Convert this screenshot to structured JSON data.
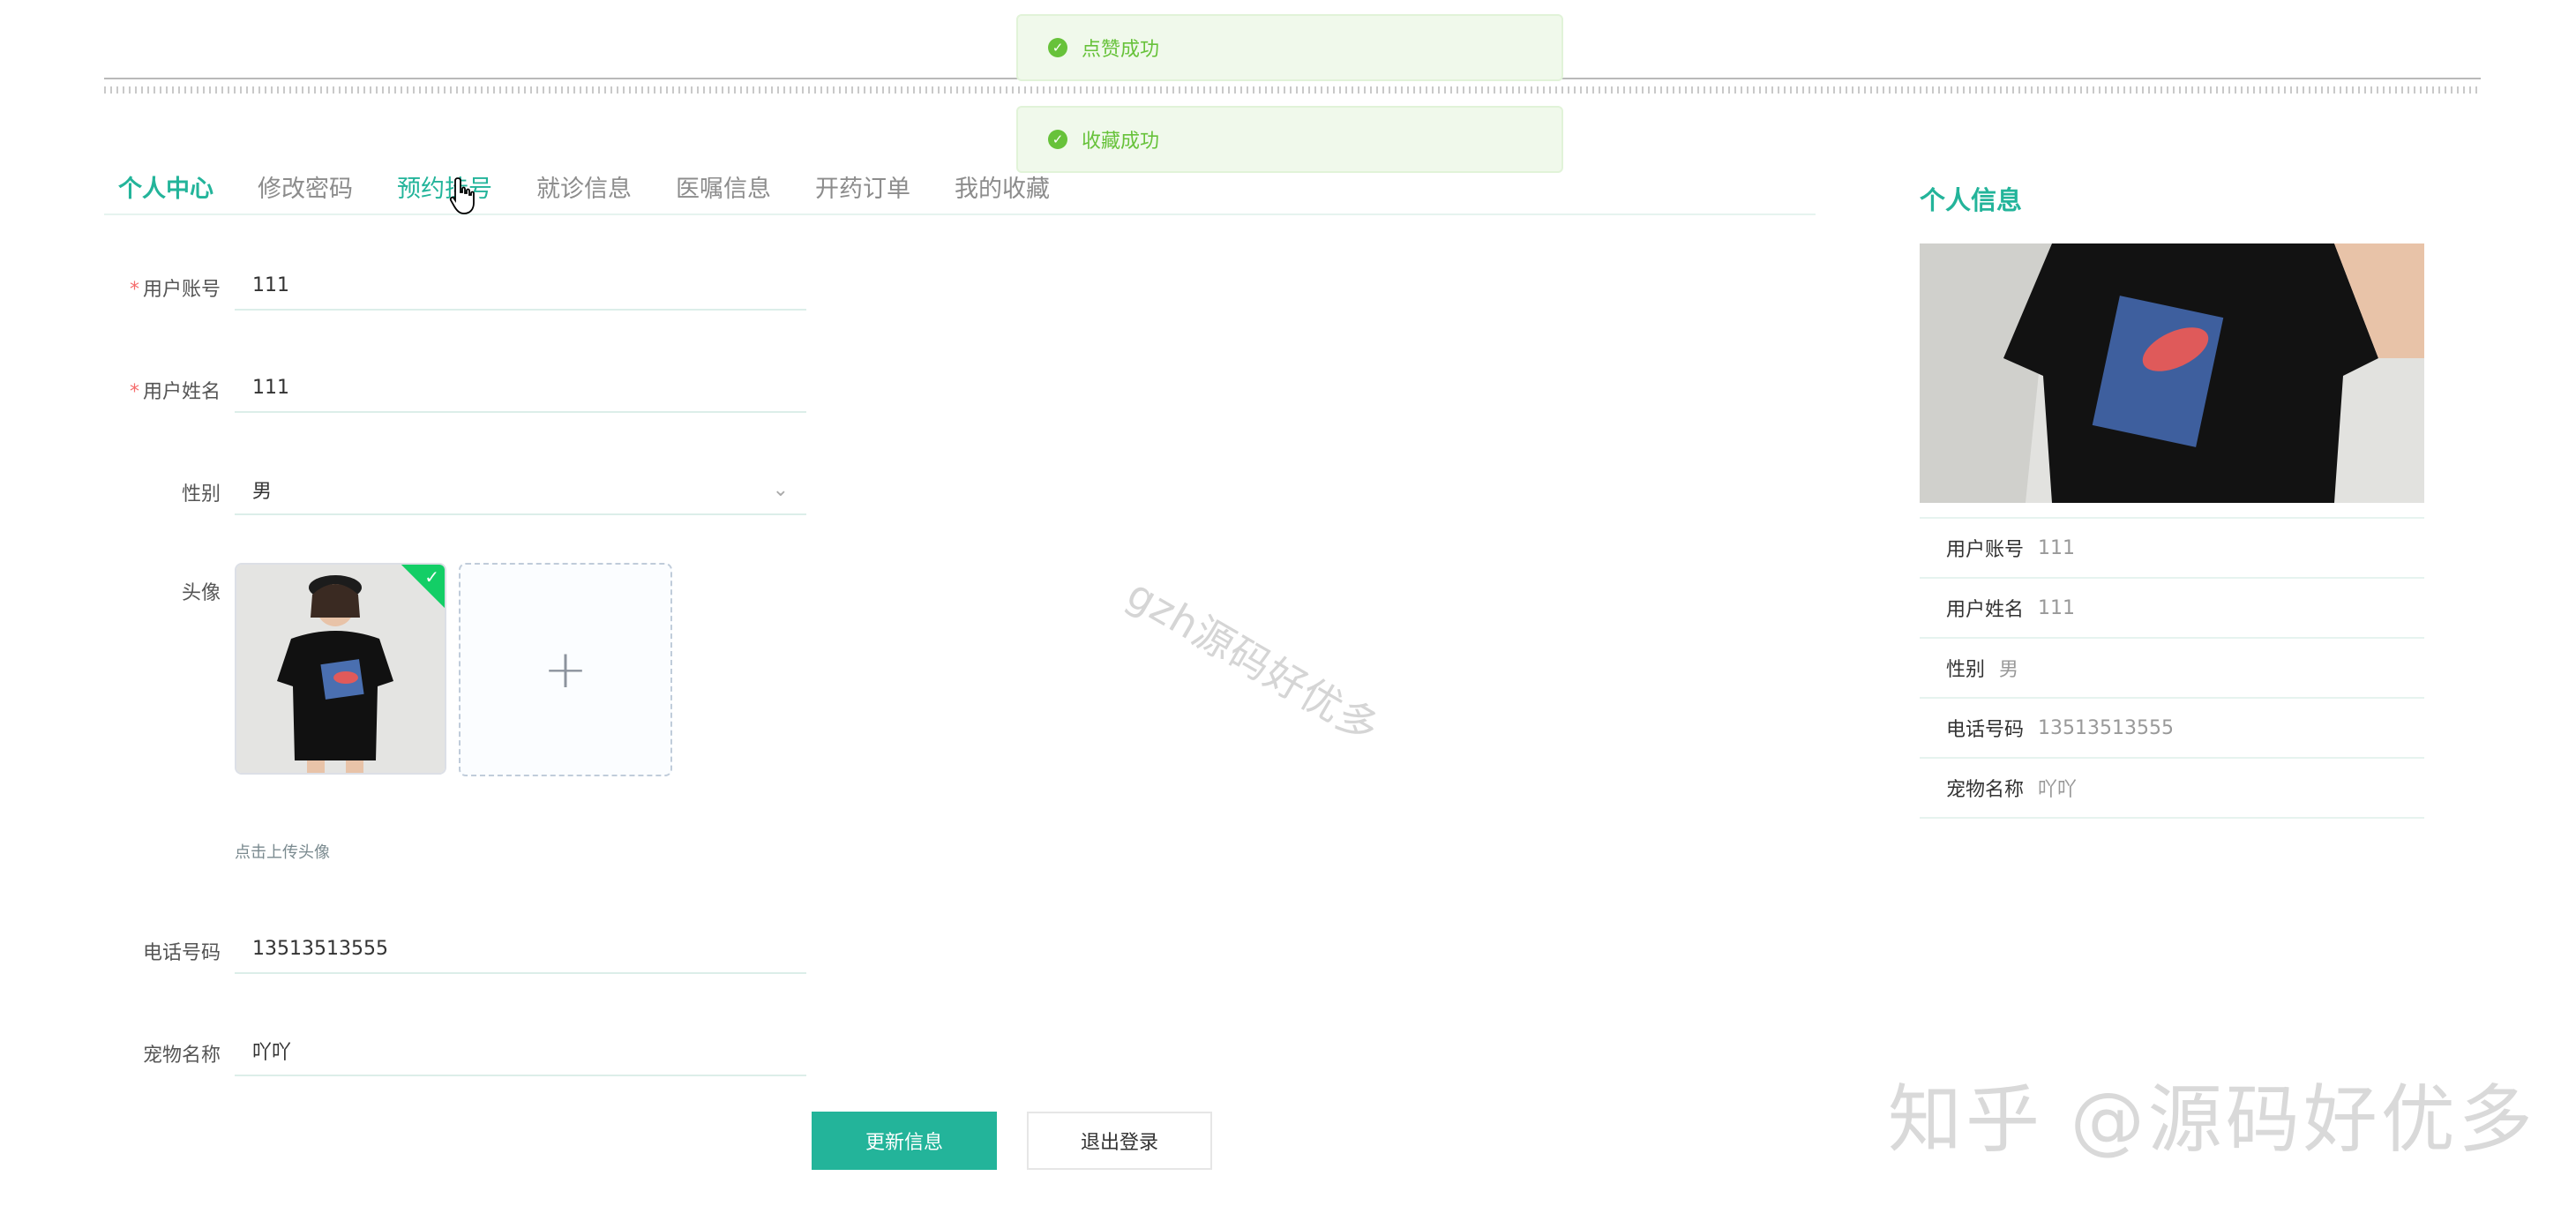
{
  "toasts": [
    {
      "text": "点赞成功"
    },
    {
      "text": "收藏成功"
    }
  ],
  "tabs": [
    {
      "label": "个人中心",
      "state": "active"
    },
    {
      "label": "修改密码",
      "state": "normal"
    },
    {
      "label": "预约挂号",
      "state": "hover"
    },
    {
      "label": "就诊信息",
      "state": "normal"
    },
    {
      "label": "医嘱信息",
      "state": "normal"
    },
    {
      "label": "开药订单",
      "state": "normal"
    },
    {
      "label": "我的收藏",
      "state": "normal"
    }
  ],
  "form": {
    "account": {
      "label": "用户账号",
      "value": "111",
      "required": true
    },
    "name": {
      "label": "用户姓名",
      "value": "111",
      "required": true
    },
    "gender": {
      "label": "性别",
      "value": "男"
    },
    "avatar": {
      "label": "头像",
      "tip": "点击上传头像"
    },
    "phone": {
      "label": "电话号码",
      "value": "13513513555"
    },
    "pet": {
      "label": "宠物名称",
      "value": "吖吖"
    },
    "required_mark": "*",
    "update_button": "更新信息",
    "logout_button": "退出登录"
  },
  "watermark": "gzh源码好优多",
  "brand_watermark": "知乎 @源码好优多",
  "side": {
    "title": "个人信息",
    "rows": [
      {
        "label": "用户账号",
        "value": "111"
      },
      {
        "label": "用户姓名",
        "value": "111"
      },
      {
        "label": "性别",
        "value": "男"
      },
      {
        "label": "电话号码",
        "value": "13513513555"
      },
      {
        "label": "宠物名称",
        "value": "吖吖"
      }
    ]
  },
  "colors": {
    "accent": "#23b49a",
    "success": "#67c23a",
    "required": "#f56c6c"
  }
}
